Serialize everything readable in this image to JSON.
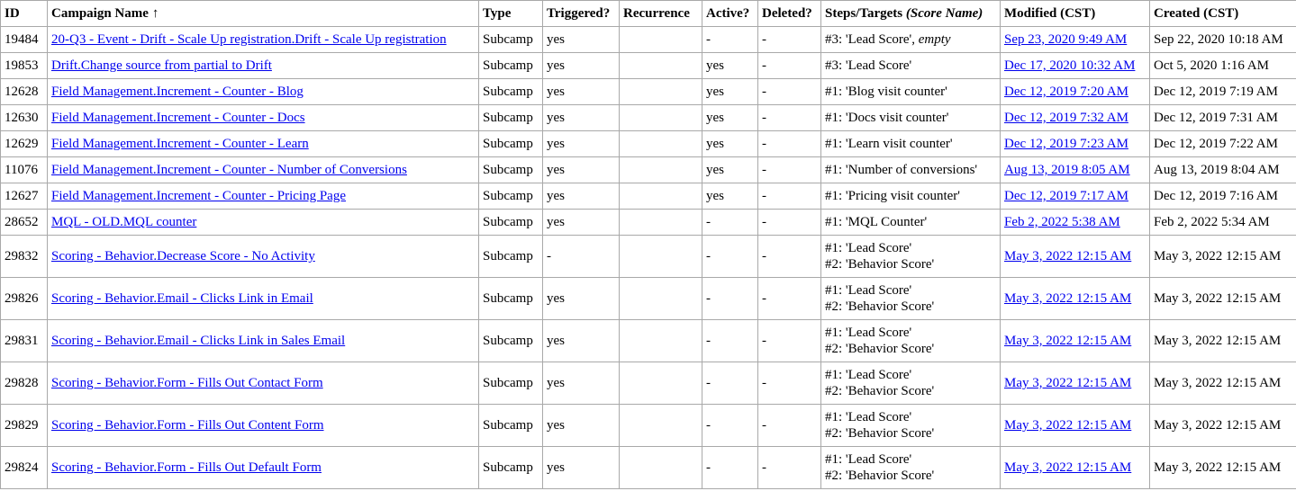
{
  "columns": {
    "id": "ID",
    "name": "Campaign Name",
    "sort_arrow": "↑",
    "type": "Type",
    "triggered": "Triggered?",
    "recurrence": "Recurrence",
    "active": "Active?",
    "deleted": "Deleted?",
    "steps_prefix": "Steps/Targets",
    "steps_suffix": "(Score Name)",
    "modified": "Modified (CST)",
    "created": "Created (CST)"
  },
  "rows": [
    {
      "id": "19484",
      "name": "20-Q3 - Event - Drift - Scale Up registration.Drift - Scale Up registration",
      "type": "Subcamp",
      "triggered": "yes",
      "recurrence": "",
      "active": "-",
      "deleted": "-",
      "steps": [
        "#3: 'Lead Score',"
      ],
      "steps_extra": "empty",
      "modified": "Sep 23, 2020 9:49 AM",
      "created": "Sep 22, 2020 10:18 AM"
    },
    {
      "id": "19853",
      "name": "Drift.Change source from partial to Drift",
      "type": "Subcamp",
      "triggered": "yes",
      "recurrence": "",
      "active": "yes",
      "deleted": "-",
      "steps": [
        "#3: 'Lead Score'"
      ],
      "modified": "Dec 17, 2020 10:32 AM",
      "created": "Oct 5, 2020 1:16 AM"
    },
    {
      "id": "12628",
      "name": "Field Management.Increment - Counter - Blog",
      "type": "Subcamp",
      "triggered": "yes",
      "recurrence": "",
      "active": "yes",
      "deleted": "-",
      "steps": [
        "#1: 'Blog visit counter'"
      ],
      "modified": "Dec 12, 2019 7:20 AM",
      "created": "Dec 12, 2019 7:19 AM"
    },
    {
      "id": "12630",
      "name": "Field Management.Increment - Counter - Docs",
      "type": "Subcamp",
      "triggered": "yes",
      "recurrence": "",
      "active": "yes",
      "deleted": "-",
      "steps": [
        "#1: 'Docs visit counter'"
      ],
      "modified": "Dec 12, 2019 7:32 AM",
      "created": "Dec 12, 2019 7:31 AM"
    },
    {
      "id": "12629",
      "name": "Field Management.Increment - Counter - Learn",
      "type": "Subcamp",
      "triggered": "yes",
      "recurrence": "",
      "active": "yes",
      "deleted": "-",
      "steps": [
        "#1: 'Learn visit counter'"
      ],
      "modified": "Dec 12, 2019 7:23 AM",
      "created": "Dec 12, 2019 7:22 AM"
    },
    {
      "id": "11076",
      "name": "Field Management.Increment - Counter - Number of Conversions",
      "type": "Subcamp",
      "triggered": "yes",
      "recurrence": "",
      "active": "yes",
      "deleted": "-",
      "steps": [
        "#1: 'Number of conversions'"
      ],
      "modified": "Aug 13, 2019 8:05 AM",
      "created": "Aug 13, 2019 8:04 AM"
    },
    {
      "id": "12627",
      "name": "Field Management.Increment - Counter - Pricing Page",
      "type": "Subcamp",
      "triggered": "yes",
      "recurrence": "",
      "active": "yes",
      "deleted": "-",
      "steps": [
        "#1: 'Pricing visit counter'"
      ],
      "modified": "Dec 12, 2019 7:17 AM",
      "created": "Dec 12, 2019 7:16 AM"
    },
    {
      "id": "28652",
      "name": "MQL - OLD.MQL counter",
      "type": "Subcamp",
      "triggered": "yes",
      "recurrence": "",
      "active": "-",
      "deleted": "-",
      "steps": [
        "#1: 'MQL Counter'"
      ],
      "modified": "Feb 2, 2022 5:38 AM",
      "created": "Feb 2, 2022 5:34 AM"
    },
    {
      "id": "29832",
      "name": "Scoring - Behavior.Decrease Score - No Activity",
      "type": "Subcamp",
      "triggered": "-",
      "recurrence": "",
      "active": "-",
      "deleted": "-",
      "steps": [
        "#1: 'Lead Score'",
        "#2: 'Behavior Score'"
      ],
      "modified": "May 3, 2022 12:15 AM",
      "created": "May 3, 2022 12:15 AM"
    },
    {
      "id": "29826",
      "name": "Scoring - Behavior.Email - Clicks Link in Email",
      "type": "Subcamp",
      "triggered": "yes",
      "recurrence": "",
      "active": "-",
      "deleted": "-",
      "steps": [
        "#1: 'Lead Score'",
        "#2: 'Behavior Score'"
      ],
      "modified": "May 3, 2022 12:15 AM",
      "created": "May 3, 2022 12:15 AM"
    },
    {
      "id": "29831",
      "name": "Scoring - Behavior.Email - Clicks Link in Sales Email",
      "type": "Subcamp",
      "triggered": "yes",
      "recurrence": "",
      "active": "-",
      "deleted": "-",
      "steps": [
        "#1: 'Lead Score'",
        "#2: 'Behavior Score'"
      ],
      "modified": "May 3, 2022 12:15 AM",
      "created": "May 3, 2022 12:15 AM"
    },
    {
      "id": "29828",
      "name": "Scoring - Behavior.Form - Fills Out Contact Form",
      "type": "Subcamp",
      "triggered": "yes",
      "recurrence": "",
      "active": "-",
      "deleted": "-",
      "steps": [
        "#1: 'Lead Score'",
        "#2: 'Behavior Score'"
      ],
      "modified": "May 3, 2022 12:15 AM",
      "created": "May 3, 2022 12:15 AM"
    },
    {
      "id": "29829",
      "name": "Scoring - Behavior.Form - Fills Out Content Form",
      "type": "Subcamp",
      "triggered": "yes",
      "recurrence": "",
      "active": "-",
      "deleted": "-",
      "steps": [
        "#1: 'Lead Score'",
        "#2: 'Behavior Score'"
      ],
      "modified": "May 3, 2022 12:15 AM",
      "created": "May 3, 2022 12:15 AM"
    },
    {
      "id": "29824",
      "name": "Scoring - Behavior.Form - Fills Out Default Form",
      "type": "Subcamp",
      "triggered": "yes",
      "recurrence": "",
      "active": "-",
      "deleted": "-",
      "steps": [
        "#1: 'Lead Score'",
        "#2: 'Behavior Score'"
      ],
      "modified": "May 3, 2022 12:15 AM",
      "created": "May 3, 2022 12:15 AM"
    }
  ]
}
